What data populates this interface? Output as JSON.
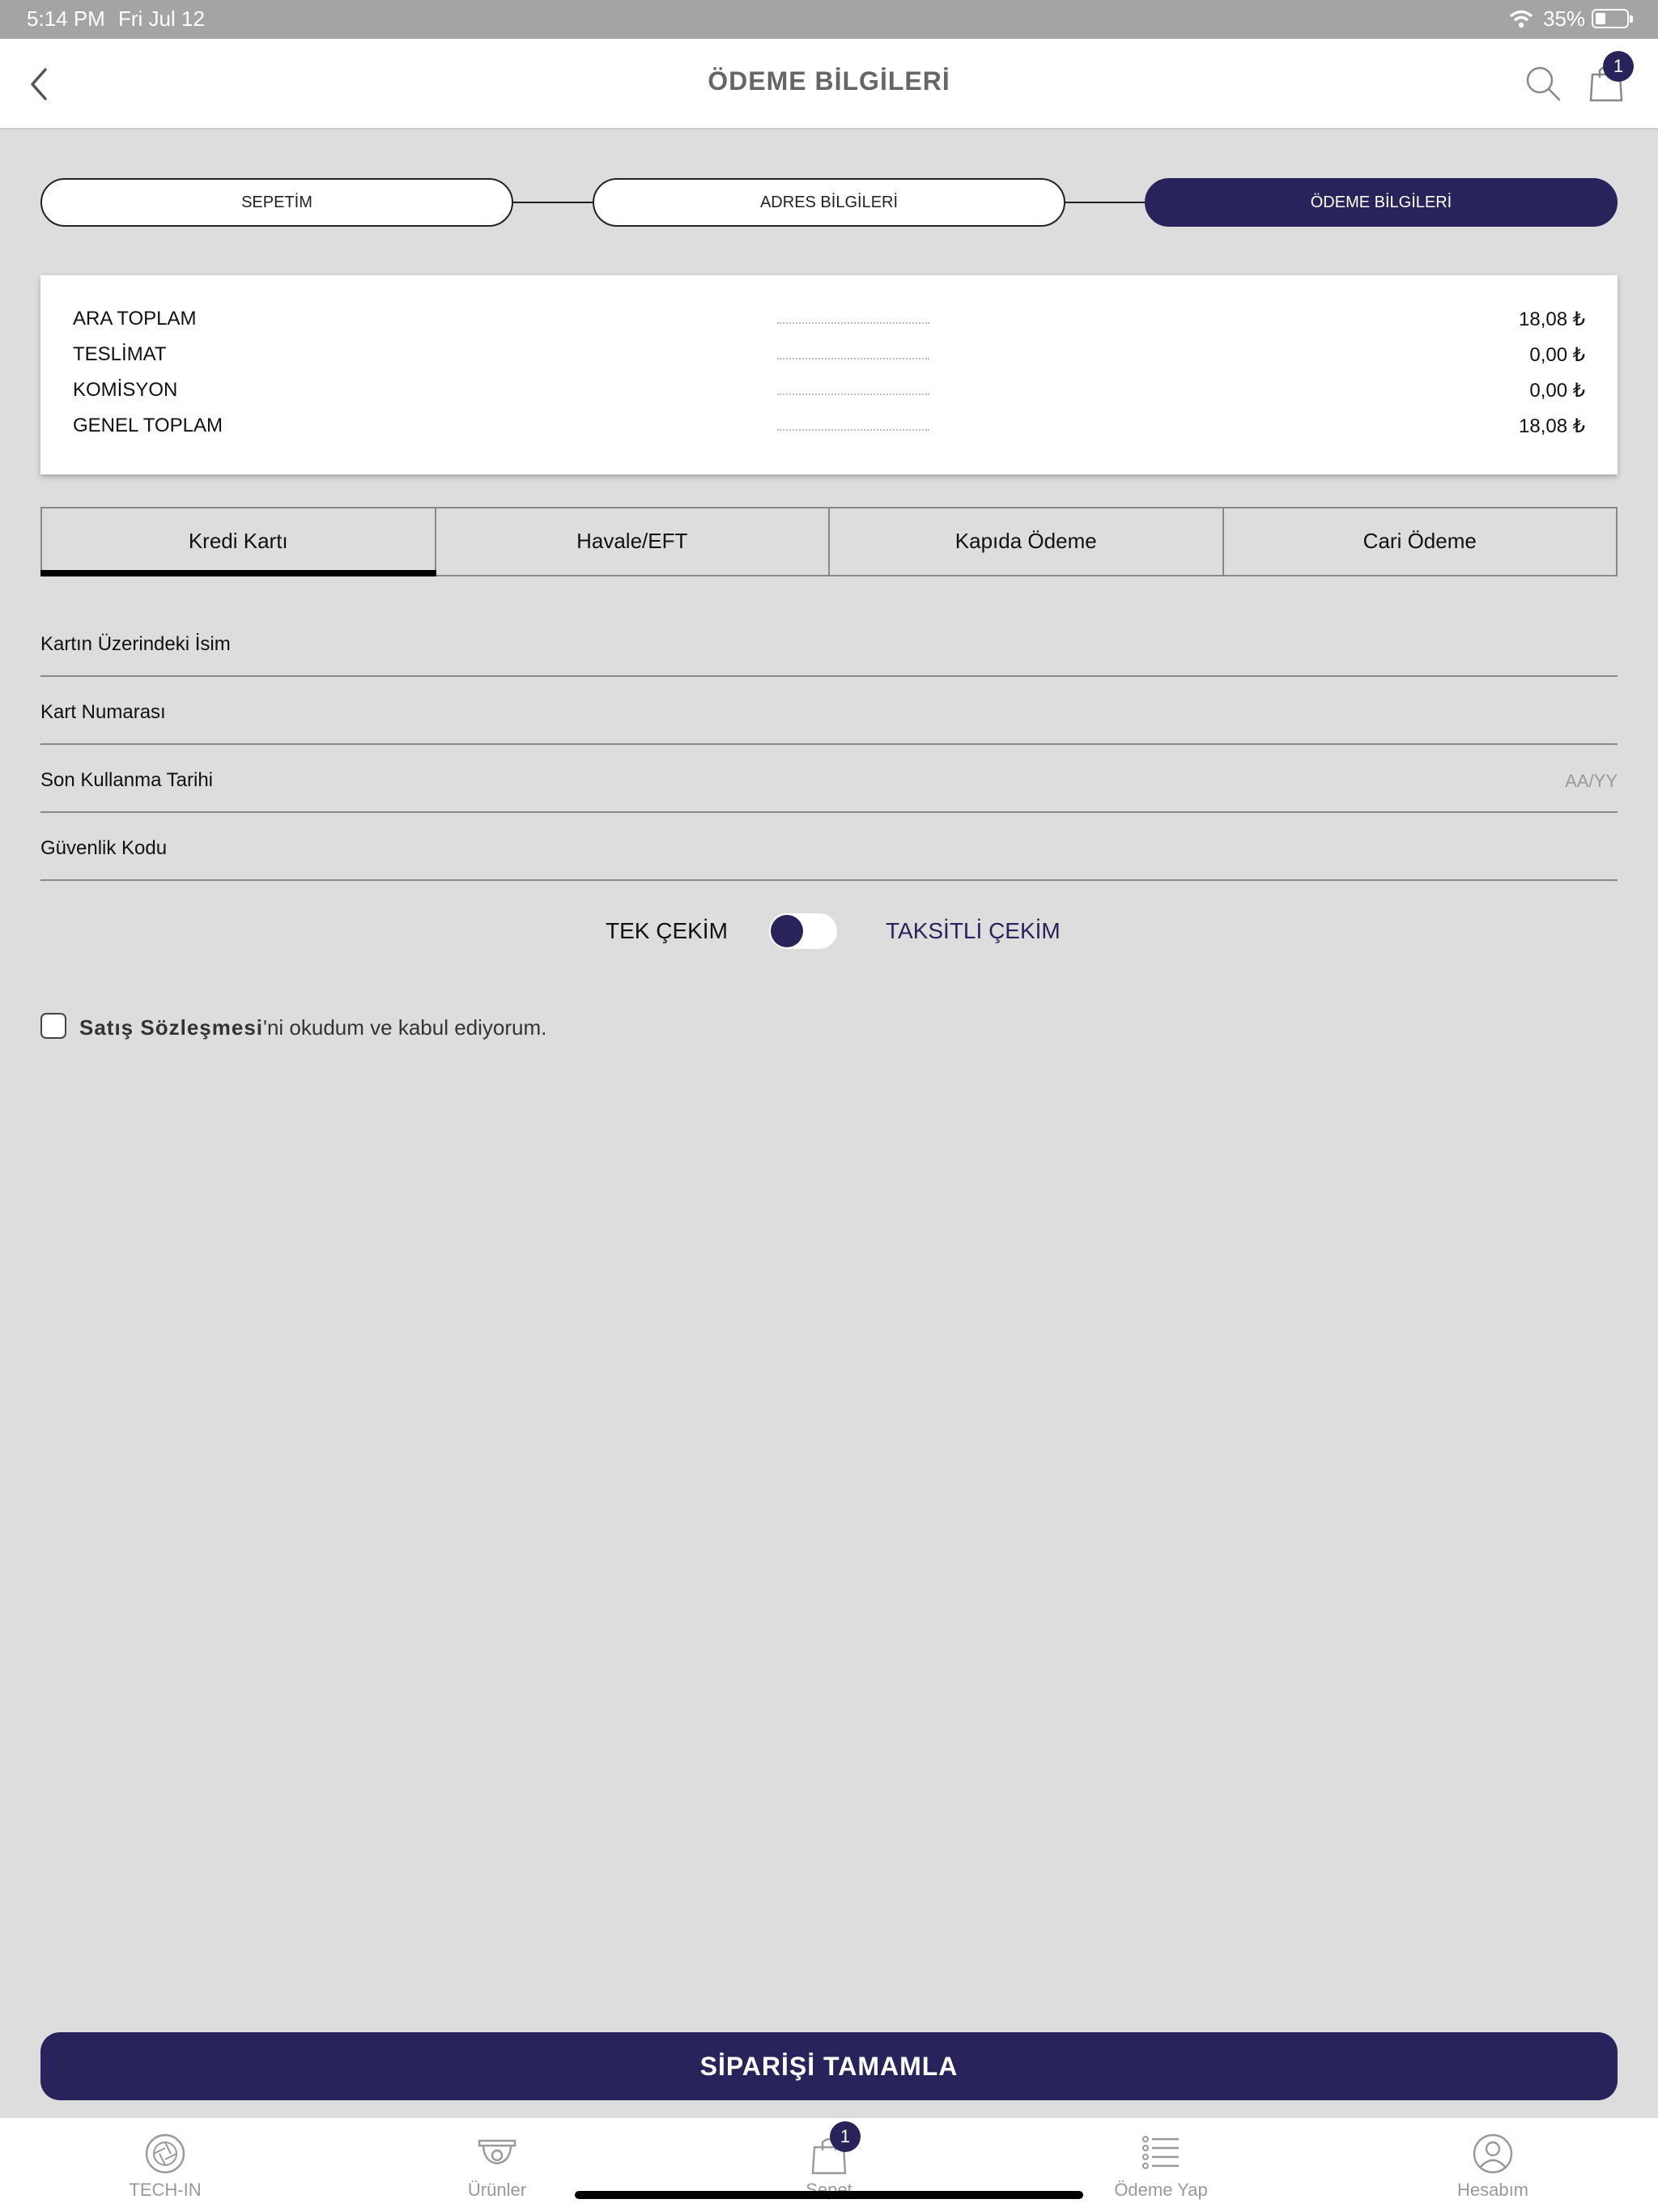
{
  "status_bar": {
    "time": "5:14 PM",
    "date": "Fri Jul 12",
    "battery": "35%"
  },
  "header": {
    "title": "ÖDEME BİLGİLERİ",
    "cart_count": "1"
  },
  "stepper": {
    "steps": [
      {
        "label": "SEPETİM"
      },
      {
        "label": "ADRES BİLGİLERİ"
      },
      {
        "label": "ÖDEME BİLGİLERİ"
      }
    ],
    "active_index": 2
  },
  "summary": {
    "rows": [
      {
        "label": "ARA TOPLAM",
        "value": "18,08 ₺"
      },
      {
        "label": "TESLİMAT",
        "value": "0,00 ₺"
      },
      {
        "label": "KOMİSYON",
        "value": "0,00 ₺"
      },
      {
        "label": "GENEL TOPLAM",
        "value": "18,08 ₺"
      }
    ]
  },
  "payment_tabs": {
    "items": [
      {
        "label": "Kredi Kartı"
      },
      {
        "label": "Havale/EFT"
      },
      {
        "label": "Kapıda Ödeme"
      },
      {
        "label": "Cari Ödeme"
      }
    ],
    "active_index": 0
  },
  "form": {
    "card_name": {
      "label": "Kartın Üzerindeki İsim"
    },
    "card_number": {
      "label": "Kart Numarası"
    },
    "expiry": {
      "label": "Son Kullanma Tarihi",
      "placeholder": "AA/YY"
    },
    "cvv": {
      "label": "Güvenlik Kodu"
    }
  },
  "installment": {
    "single_label": "TEK ÇEKİM",
    "installment_label": "TAKSİTLİ ÇEKİM"
  },
  "agreement": {
    "link_text": "Satış Sözleşmesi",
    "rest_text": "'ni okudum ve kabul ediyorum."
  },
  "submit_label": "SİPARİŞİ TAMAMLA",
  "tab_bar": {
    "items": [
      {
        "label": "TECH-IN",
        "icon": "aperture-icon"
      },
      {
        "label": "Ürünler",
        "icon": "camera-icon"
      },
      {
        "label": "Sepet",
        "icon": "bag-icon"
      },
      {
        "label": "Ödeme Yap",
        "icon": "list-icon"
      },
      {
        "label": "Hesabım",
        "icon": "user-icon"
      }
    ],
    "cart_badge": "1"
  },
  "colors": {
    "accent": "#28235b",
    "background": "#dddddd"
  }
}
